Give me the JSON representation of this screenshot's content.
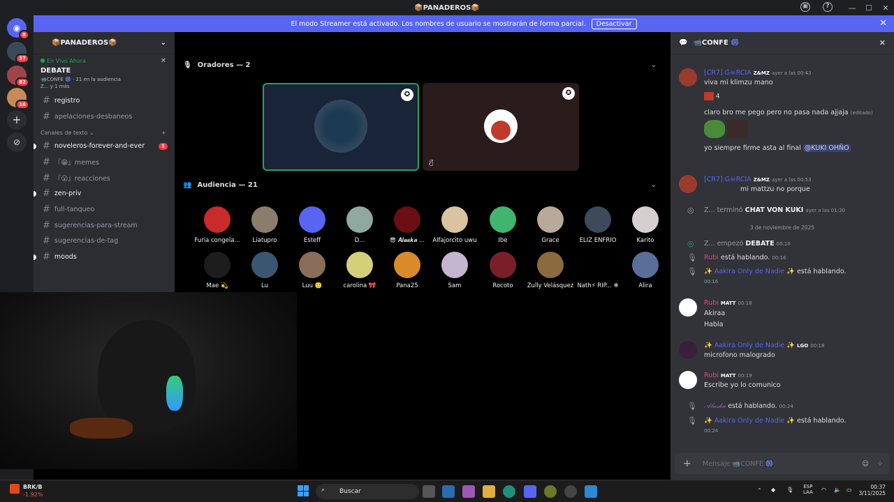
{
  "window": {
    "title": "📦PANADEROS📦"
  },
  "banner": {
    "text": "El modo Streamer está activado. Los nombres de usuario se mostrarán de forma parcial.",
    "button": "Desactivar"
  },
  "guilds": [
    {
      "badge": "8"
    },
    {
      "badge": "37"
    },
    {
      "badge": "82"
    },
    {
      "badge": "16"
    }
  ],
  "server": {
    "name": "📦PANADEROS📦",
    "live_label": "En Vivo Ahora",
    "live_event": "DEBATE",
    "live_channel": "📹CONFE 🎆",
    "live_audience": "21 en la audiencia",
    "live_more": "Z... y 1 más",
    "channels_top": [
      "registro",
      "apelaciones-desbaneos"
    ],
    "category": "Canales de texto",
    "channels": [
      {
        "name": "noveleros-forever-and-ever",
        "badge": "1"
      },
      {
        "name": "『😁』memes"
      },
      {
        "name": "『😮』reacciones"
      },
      {
        "name": "zen-priv"
      },
      {
        "name": "full-tanqueo"
      },
      {
        "name": "sugerencias-para-stream"
      },
      {
        "name": "sugerencias-de-tag"
      },
      {
        "name": "moods"
      }
    ]
  },
  "stage": {
    "speakers_label": "Oradores — 2",
    "audience_label": "Audiencia — 21",
    "audience": [
      {
        "name": "Furia congela...",
        "color": "#c92a2a"
      },
      {
        "name": "Liatupro",
        "color": "#8a7d6b"
      },
      {
        "name": "Esteff",
        "color": "#5865f2"
      },
      {
        "name": "D...",
        "color": "#8fa9a0"
      },
      {
        "name": "😎 𝑨𝒍𝒂𝒔𝒌𝒂 ...",
        "color": "#6b0f14"
      },
      {
        "name": "Alfajorcito uwu",
        "color": "#d9c3a0"
      },
      {
        "name": "Ibe",
        "color": "#3fb56e"
      },
      {
        "name": "Grace",
        "color": "#b8a99a"
      },
      {
        "name": "ELIZ ENFRIO",
        "color": "#3d4a5c"
      },
      {
        "name": "Karito",
        "color": "#d6cfd0"
      },
      {
        "name": "Mae 💫",
        "color": "#1d1d1d"
      },
      {
        "name": "Lu",
        "color": "#3a5670"
      },
      {
        "name": "Luu 🙂",
        "color": "#8a6e5a"
      },
      {
        "name": "carolina 🎀",
        "color": "#d4d07a"
      },
      {
        "name": "Pana25",
        "color": "#d98a2a"
      },
      {
        "name": "Sam",
        "color": "#c4b5d0"
      },
      {
        "name": "Rocoto",
        "color": "#7a1f2a"
      },
      {
        "name": "Zully Velásquez",
        "color": "#8a6a3e"
      },
      {
        "name": "Nath⚡︎ RIP... ❄",
        "color": "#000000"
      },
      {
        "name": "Alira",
        "color": "#5a6e9a"
      }
    ]
  },
  "chat": {
    "channel": "📹CONFE 🎆",
    "messages": [
      {
        "user": "[CR7] G☠RCIA",
        "tag": "Z&MZ",
        "time": "ayer a las 00:43",
        "lines": [
          "viva mi klimzu mano"
        ],
        "reaction_count": "4"
      },
      {
        "line": "claro bro me pego pero no pasa nada ajjaja",
        "edited": "(editado)"
      },
      {
        "line": "yo siempre firme asta al final",
        "mention": "@KUKI OHÑO"
      },
      {
        "user": "[CR7] G☠RCIA",
        "tag": "Z&MZ",
        "time": "ayer a las 00:53",
        "lines": [
          "mi mattzu no  porque"
        ]
      },
      {
        "system": "Z... terminó",
        "bold": "CHAT VON KUKI",
        "time": "ayer a las 01:30"
      },
      {
        "divider": "3 de noviembre de 2025"
      },
      {
        "system": "Z... empezó",
        "bold": "DEBATE",
        "time": "00:10"
      },
      {
        "user": "Rubi",
        "action": "está hablando.",
        "time": "00:16"
      },
      {
        "user": "✨ Aakira Only de Nadie ✨",
        "action": "está hablando.",
        "time": "00:16"
      },
      {
        "user": "Rubi",
        "tag": "MATT",
        "time": "00:18",
        "lines": [
          "Akiraa",
          "Habla"
        ]
      },
      {
        "user": "✨ Aakira Only de Nadie ✨",
        "tag": "LGO",
        "time": "00:18",
        "lines": [
          "microfono malogrado"
        ]
      },
      {
        "user": "Rubi",
        "tag": "MATT",
        "time": "00:19",
        "lines": [
          "Escribe yo lo comunico"
        ]
      },
      {
        "user": "𝒜𝓁𝒶𝓈𝓀𝒶",
        "action": "está hablando.",
        "time": "00:24"
      },
      {
        "user": "✨ Aakira Only de Nadie ✨",
        "action": "está hablando.",
        "time": "00:24"
      }
    ],
    "input_placeholder": "Mensaje 📹CONFE 🎆"
  },
  "taskbar": {
    "stock": "BRK/B",
    "change": "-1.92%",
    "search": "Buscar",
    "lang1": "ESP",
    "lang2": "LAA",
    "time": "00:37",
    "date": "3/11/2025"
  }
}
